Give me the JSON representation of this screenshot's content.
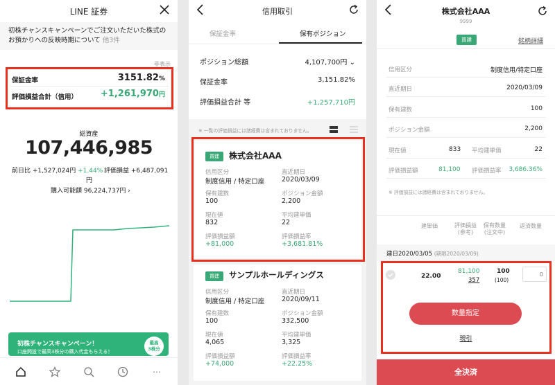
{
  "p1": {
    "title": "LINE 証券",
    "notice_line1": "初株チャンスキャンペーンでご注文いただいた株式の",
    "notice_line2": "お預かりへの反映時期について",
    "notice_more": "他3件",
    "hide_label": "非表示",
    "margin_rate_label": "保証金率",
    "margin_rate_value": "3151.82",
    "margin_rate_unit": "%",
    "pl_label": "評価損益合計（信用）",
    "pl_value": "+1,261,970",
    "pl_unit": "円",
    "total_label": "総資産",
    "total_value": "107,446,985",
    "daychange_label": "前日比",
    "daychange_value": "+1,527,024円",
    "daychange_pct": "+1.44%",
    "eval_label": "評価損益",
    "eval_value": "+6,487,091",
    "eval_unit": "円",
    "buying_power_label": "購入可能額",
    "buying_power_value": "96,224,737円",
    "banner_title": "初株チャンスキャンペーン！",
    "banner_sub": "口座開設で最高3株分の購入代金もらえる！",
    "banner_badge1": "最高",
    "banner_badge2": "3株分",
    "nav": [
      "home-icon",
      "star-icon",
      "search-icon",
      "clock-icon",
      "more-icon"
    ],
    "nav_more": "…"
  },
  "p2": {
    "title": "信用取引",
    "tab_margin": "保証金率",
    "tab_position": "保有ポジション",
    "pos_total_label": "ポジション総額",
    "pos_total_value": "4,107,700円",
    "margin_label": "保証金率",
    "margin_value": "3,151.82%",
    "pl_label": "評価損益合計 等",
    "pl_value": "+1,257,710円",
    "note": "※ 一覧の評価損益には諸経費は含まれておりません。",
    "cards": [
      {
        "badge": "買建",
        "name": "株式会社AAA",
        "f1_label": "信用区分",
        "f1_value": "制度信用 / 特定口座",
        "f2_label": "直近期日",
        "f2_value": "2020/03/09",
        "f3_label": "保有建数",
        "f3_value": "100",
        "f4_label": "ポジション金額",
        "f4_value": "2,200",
        "f5_label": "現在値",
        "f5_value": "832",
        "f6_label": "平均建単価",
        "f6_value": "22",
        "f7_label": "評価損益額",
        "f7_value": "+81,000",
        "f8_label": "評価損益率",
        "f8_value": "+3,681.81%"
      },
      {
        "badge": "買建",
        "name": "サンプルホールディングス",
        "f1_label": "信用区分",
        "f1_value": "制度信用 / 特定口座",
        "f2_label": "直近期日",
        "f2_value": "2020/09/11",
        "f3_label": "保有建数",
        "f3_value": "100",
        "f4_label": "ポジション金額",
        "f4_value": "332,500",
        "f5_label": "現在値",
        "f5_value": "4,065",
        "f6_label": "平均建単価",
        "f6_value": "3,325",
        "f7_label": "評価損益額",
        "f7_value": "+74,000",
        "f8_label": "評価損益率",
        "f8_value": "+22.25%"
      }
    ]
  },
  "p3": {
    "title": "株式会社AAA",
    "code": "9999",
    "badge": "買建",
    "detail_link": "銘柄詳細",
    "rows": [
      {
        "label": "信用区分",
        "value": "制度信用/特定口座"
      },
      {
        "label": "直近期日",
        "value": "2020/03/09"
      },
      {
        "label": "保有建数",
        "value": "100"
      },
      {
        "label": "ポジション金額",
        "value": "2,200"
      }
    ],
    "cur_label": "現在値",
    "cur_value": "833",
    "avg_label": "平均建単価",
    "avg_value": "22",
    "pl_label": "評価損益額",
    "pl_value": "81,100",
    "plr_label": "評価損益率",
    "plr_value": "3,686.36%",
    "note": "※ 評価損益には諸経費は含まれておりません。",
    "col_price": "建単価",
    "col_pl1": "評価損益",
    "col_pl2": "(参考)",
    "col_qty1": "保有数量",
    "col_qty2": "(注文中)",
    "col_return": "返済数量",
    "build_date": "建日2020/03/05",
    "deadline": "(期限2020/03/09)",
    "lot_price": "22.00",
    "lot_pl": "81,100",
    "lot_pl2": "357",
    "lot_qty": "100",
    "lot_qty2": "(100)",
    "lot_return_placeholder": "0",
    "qty_button": "数量指定",
    "reset_link": "現引",
    "settle_all": "全決済"
  }
}
